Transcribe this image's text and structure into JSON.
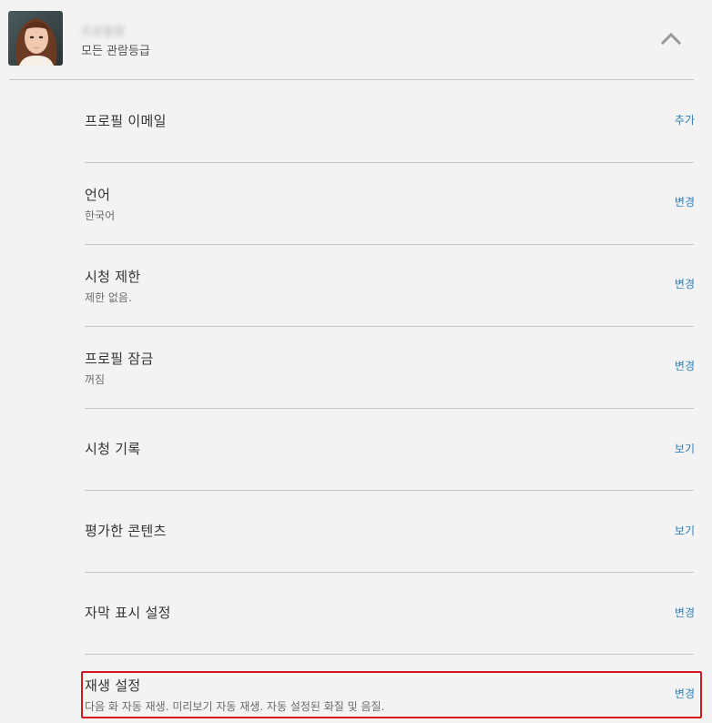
{
  "profile": {
    "name": "프로필명",
    "maturity_rating": "모든 관람등급",
    "avatar_icon": "profile-avatar",
    "collapse_icon": "chevron-up-icon"
  },
  "settings": [
    {
      "title": "프로필 이메일",
      "subtitle": "",
      "action": "추가"
    },
    {
      "title": "언어",
      "subtitle": "한국어",
      "action": "변경"
    },
    {
      "title": "시청 제한",
      "subtitle": "제한 없음.",
      "action": "변경"
    },
    {
      "title": "프로필 잠금",
      "subtitle": "꺼짐",
      "action": "변경"
    },
    {
      "title": "시청 기록",
      "subtitle": "",
      "action": "보기"
    },
    {
      "title": "평가한 콘텐츠",
      "subtitle": "",
      "action": "보기"
    },
    {
      "title": "자막 표시 설정",
      "subtitle": "",
      "action": "변경"
    },
    {
      "title": "재생 설정",
      "subtitle": "다음 화 자동 재생. 미리보기 자동 재생. 자동 설정된 화질 및 음질.",
      "action": "변경"
    }
  ],
  "colors": {
    "background": "#f3f3f3",
    "link": "#2f7fb5",
    "highlight": "#d9141c",
    "divider": "#c8c8c8"
  }
}
